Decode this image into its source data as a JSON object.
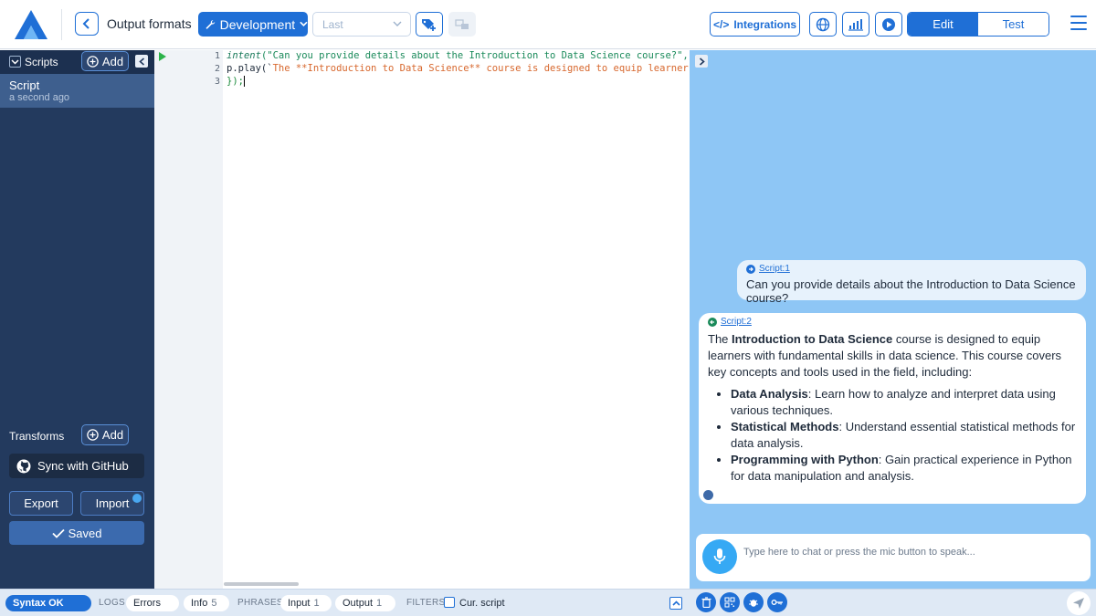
{
  "header": {
    "title": "Output formats",
    "environment_label": "Development",
    "version_select_value": "Last",
    "integrations_label": "Integrations",
    "mode_edit_label": "Edit",
    "mode_test_label": "Test"
  },
  "sidebar": {
    "scripts_label": "Scripts",
    "add_label": "Add",
    "scripts": [
      {
        "name": "Script",
        "time": "a second ago"
      }
    ],
    "transforms_label": "Transforms",
    "github_label": "Sync with GitHub",
    "export_label": "Export",
    "import_label": "Import",
    "saved_label": "Saved"
  },
  "editor": {
    "line_numbers": [
      "1",
      "2",
      "3"
    ],
    "line1_fn": "intent",
    "line1_str": "(\"Can you provide details about the Introduction to Data Science course?\", p =",
    "line2_call": "    p.play(`",
    "line2_str": "The **Introduction to Data Science** course is designed to equip learner",
    "line3_close": "});"
  },
  "chat": {
    "user_link": "Script:1",
    "user_message": "Can you provide details about the Introduction to Data Science course?",
    "bot_link": "Script:2",
    "bot_intro_prefix": "The ",
    "bot_intro_bold": "Introduction to Data Science",
    "bot_intro_rest": " course is designed to equip learners with fundamental skills in data science. This course covers key concepts and tools used in the field, including:",
    "bot_items": [
      {
        "title": "Data Analysis",
        "text": ": Learn how to analyze and interpret data using various techniques."
      },
      {
        "title": "Statistical Methods",
        "text": ": Understand essential statistical methods for data analysis."
      },
      {
        "title": "Programming with Python",
        "text": ": Gain practical experience in Python for data manipulation and analysis."
      }
    ],
    "input_placeholder": "Type here to chat or press the mic button to speak..."
  },
  "statusbar": {
    "syntax": "Syntax OK",
    "logs_label": "LOGS",
    "errors_label": "Errors",
    "info_label": "Info",
    "info_count": "5",
    "phrases_label": "PHRASES",
    "input_label": "Input",
    "input_count": "1",
    "output_label": "Output",
    "output_count": "1",
    "filters_label": "FILTERS",
    "cur_script_label": "Cur. script"
  },
  "colors": {
    "accent": "#1f6fd6",
    "sidebar_bg": "#233a5e",
    "chat_bg": "#8ec6f5"
  }
}
